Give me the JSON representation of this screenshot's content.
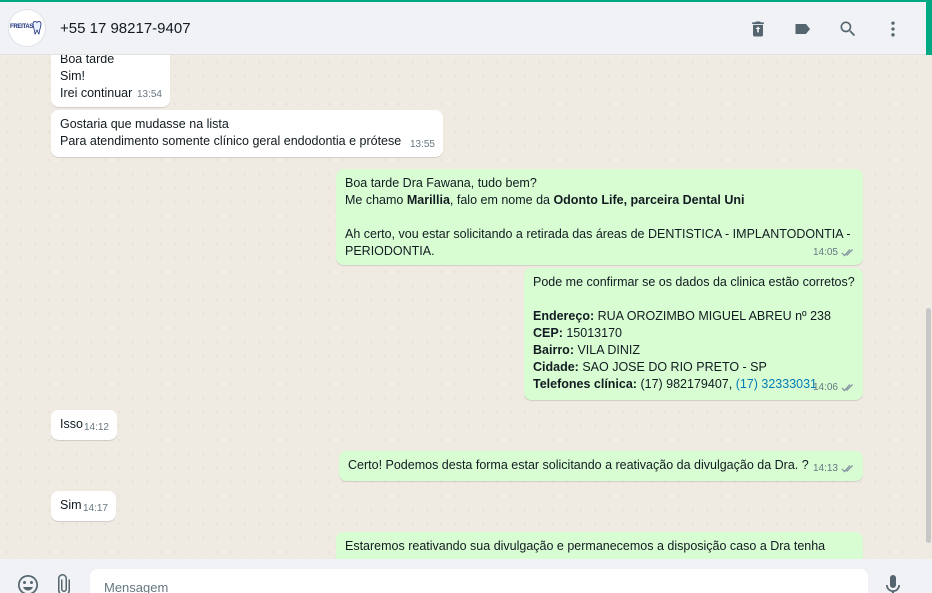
{
  "header": {
    "avatar_text": "FREITAS",
    "contact_name": "+55 17 98217-9407",
    "icons": [
      "delete-icon",
      "label-icon",
      "search-icon",
      "menu-icon"
    ]
  },
  "messages": [
    {
      "dir": "in",
      "lines": [
        "Boa tarde",
        "Sim!",
        "Irei continuar"
      ],
      "time": "13:54"
    },
    {
      "dir": "in",
      "lines": [
        "Gostaria que mudasse na lista",
        "Para atendimento somente clínico geral endodontia e prótese"
      ],
      "time": "13:55"
    },
    {
      "dir": "out",
      "time": "14:05",
      "l1": "Boa tarde Dra Fawana, tudo bem?",
      "l2a": "Me chamo ",
      "l2b": "Marillia",
      "l2c": ", falo em nome da ",
      "l2d": "Odonto Life, parceira Dental Uni",
      "l3": "Ah certo, vou estar solicitando a retirada das áreas de DENTISTICA - IMPLANTODONTIA -",
      "l4": "PERIODONTIA."
    },
    {
      "dir": "out",
      "time": "14:06",
      "intro": "Pode me confirmar se os dados da clinica estão corretos?",
      "endereco_label": "Endereço:",
      "endereco": "RUA OROZIMBO MIGUEL ABREU nº 238",
      "cep_label": "CEP:",
      "cep": "15013170",
      "bairro_label": "Bairro:",
      "bairro": "VILA DINIZ",
      "cidade_label": "Cidade:",
      "cidade": "SAO JOSE DO RIO PRETO - SP",
      "tel_label": "Telefones clínica:",
      "tel1": "(17) 982179407,",
      "tel2": "(17) 32333031"
    },
    {
      "dir": "in",
      "text": "Isso",
      "time": "14:12"
    },
    {
      "dir": "out",
      "text": "Certo! Podemos desta forma estar solicitando a reativação da divulgação da Dra. ?",
      "time": "14:13"
    },
    {
      "dir": "in",
      "text": "Sim",
      "time": "14:17"
    },
    {
      "dir": "out",
      "text": "Estaremos reativando sua divulgação e permanecemos a disposição caso a Dra tenha"
    }
  ],
  "composer": {
    "placeholder": "Mensagem",
    "icons": [
      "emoji-icon",
      "attach-icon",
      "microphone-icon"
    ]
  },
  "colors": {
    "incoming": "#ffffff",
    "outgoing": "#d9fdd3",
    "accent": "#00a884",
    "link": "#027eb5"
  }
}
